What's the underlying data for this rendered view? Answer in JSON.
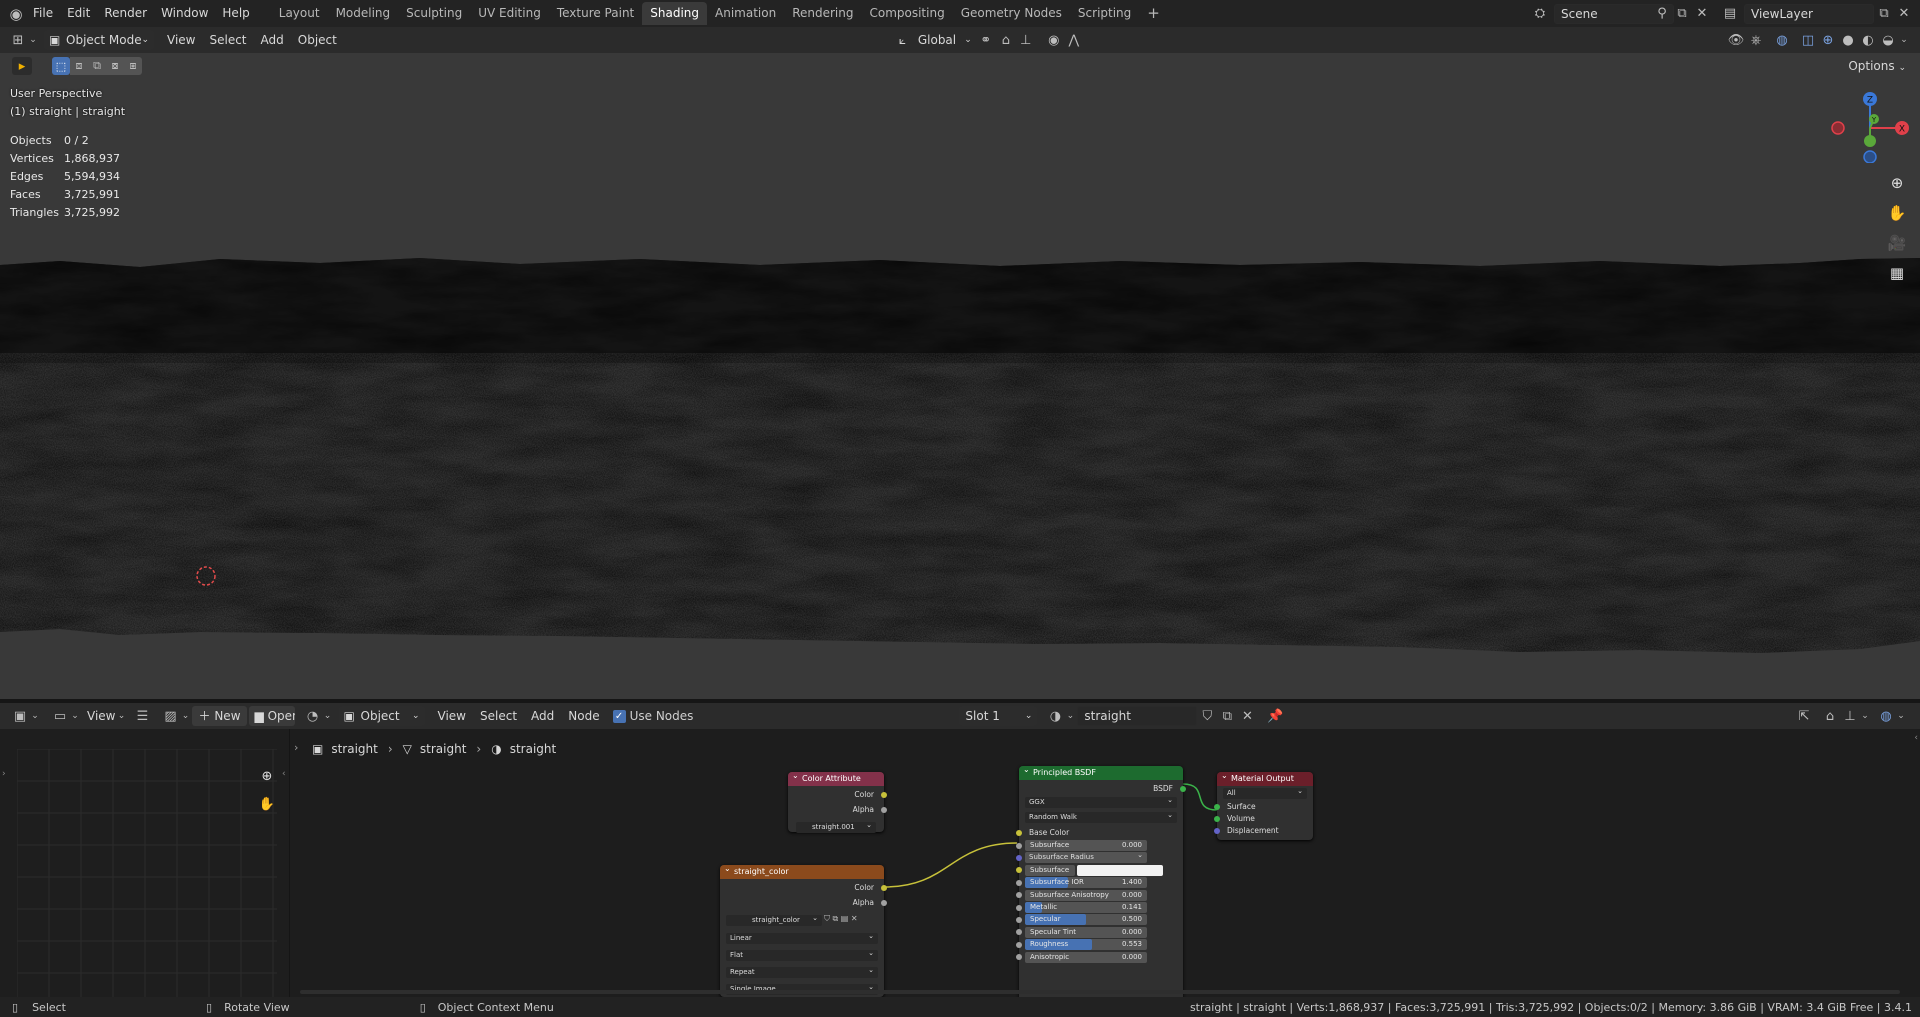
{
  "topbar": {
    "menus": [
      "File",
      "Edit",
      "Render",
      "Window",
      "Help"
    ],
    "workspaces": [
      "Layout",
      "Modeling",
      "Sculpting",
      "UV Editing",
      "Texture Paint",
      "Shading",
      "Animation",
      "Rendering",
      "Compositing",
      "Geometry Nodes",
      "Scripting"
    ],
    "active_workspace": "Shading",
    "add_workspace": "+",
    "scene": "Scene",
    "view_layer": "ViewLayer"
  },
  "viewport_header": {
    "mode": "Object Mode",
    "menus": [
      "View",
      "Select",
      "Add",
      "Object"
    ],
    "orientation": "Global",
    "options": "Options"
  },
  "viewport": {
    "perspective": "User Perspective",
    "object_label": "(1) straight | straight",
    "stats": [
      {
        "k": "Objects",
        "v": "0 / 2"
      },
      {
        "k": "Vertices",
        "v": "1,868,937"
      },
      {
        "k": "Edges",
        "v": "5,594,934"
      },
      {
        "k": "Faces",
        "v": "3,725,991"
      },
      {
        "k": "Triangles",
        "v": "3,725,992"
      }
    ],
    "gizmo": {
      "z": "Z",
      "y": "Y",
      "x": "X"
    }
  },
  "image_header": {
    "view": "View",
    "new": "New",
    "open": "Open"
  },
  "node_header": {
    "object": "Object",
    "menus": [
      "View",
      "Select",
      "Add",
      "Node"
    ],
    "use_nodes": "Use Nodes",
    "slot": "Slot 1",
    "material": "straight"
  },
  "breadcrumb": [
    "straight",
    "straight",
    "straight"
  ],
  "nodes": {
    "color_attribute": {
      "title": "Color Attribute",
      "out1": "Color",
      "out2": "Alpha",
      "attr": "straight.001"
    },
    "image": {
      "title": "straight_color",
      "out1": "Color",
      "out2": "Alpha",
      "image": "straight_color",
      "interp": "Linear",
      "proj": "Flat",
      "ext": "Repeat",
      "source": "Single Image"
    },
    "bsdf": {
      "title": "Principled BSDF",
      "out": "BSDF",
      "dist": "GGX",
      "sss": "Random Walk",
      "base": "Base Color",
      "fields": [
        {
          "label": "Subsurface",
          "value": "0.000",
          "fill": 0
        },
        {
          "label": "Subsurface Radius",
          "value": "",
          "fill": 0,
          "drop": true
        },
        {
          "label": "Subsurface Color",
          "value": "",
          "fill": 0,
          "color": true
        },
        {
          "label": "Subsurface IOR",
          "value": "1.400",
          "fill": 0.35
        },
        {
          "label": "Subsurface Anisotropy",
          "value": "0.000",
          "fill": 0
        },
        {
          "label": "Metallic",
          "value": "0.141",
          "fill": 0.141
        },
        {
          "label": "Specular",
          "value": "0.500",
          "fill": 0.5
        },
        {
          "label": "Specular Tint",
          "value": "0.000",
          "fill": 0
        },
        {
          "label": "Roughness",
          "value": "0.553",
          "fill": 0.553
        },
        {
          "label": "Anisotropic",
          "value": "0.000",
          "fill": 0
        }
      ]
    },
    "output": {
      "title": "Material Output",
      "target": "All",
      "in1": "Surface",
      "in2": "Volume",
      "in3": "Displacement"
    }
  },
  "statusbar": {
    "select": "Select",
    "rotate": "Rotate View",
    "context": "Object Context Menu",
    "info": "straight | straight | Verts:1,868,937 | Faces:3,725,991 | Tris:3,725,992 | Objects:0/2 | Memory: 3.86 GiB | VRAM: 3.4 GiB Free | 3.4.1"
  },
  "colors": {
    "accent": "#4772b3",
    "color_attr_header": "#83314a",
    "image_header": "#8b4a1c",
    "bsdf_header": "#1d6b2f",
    "output_header": "#6b1f2a",
    "link": "#c7c13a"
  }
}
